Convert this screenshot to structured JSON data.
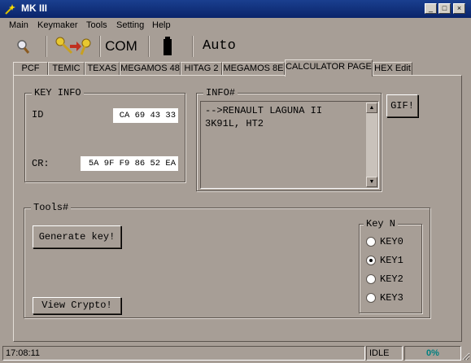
{
  "window": {
    "title": "MK III"
  },
  "menu": [
    "Main",
    "Keymaker",
    "Tools",
    "Setting",
    "Help"
  ],
  "toolbar": {
    "com_label": "COM",
    "auto_label": "Auto"
  },
  "tabs": [
    "PCF",
    "TEMIC",
    "TEXAS",
    "MEGAMOS 48",
    "HITAG 2",
    "MEGAMOS 8E",
    "CALCULATOR PAGE",
    "HEX Edit"
  ],
  "active_tab": "CALCULATOR PAGE",
  "key_info": {
    "title": "KEY INFO",
    "id_label": "ID",
    "id_value": "CA 69 43 33",
    "cr_label": "CR:",
    "cr_value": "5A 9F F9 86 52 EA"
  },
  "info": {
    "title": "INFO#",
    "lines": [
      "-->RENAULT LAGUNA II",
      "3K91L, HT2"
    ]
  },
  "gif_button": "GIF!",
  "tools": {
    "title": "Tools#",
    "generate_button": "Generate key!",
    "view_button": "View Crypto!"
  },
  "key_n": {
    "title": "Key N",
    "options": [
      "KEY0",
      "KEY1",
      "KEY2",
      "KEY3"
    ],
    "selected": "KEY1"
  },
  "status": {
    "time": "17:08:11",
    "state": "IDLE",
    "progress": "0%"
  },
  "colors": {
    "title_bar": "#0a246a",
    "background": "#a79e96",
    "progress_text": "#008080"
  }
}
